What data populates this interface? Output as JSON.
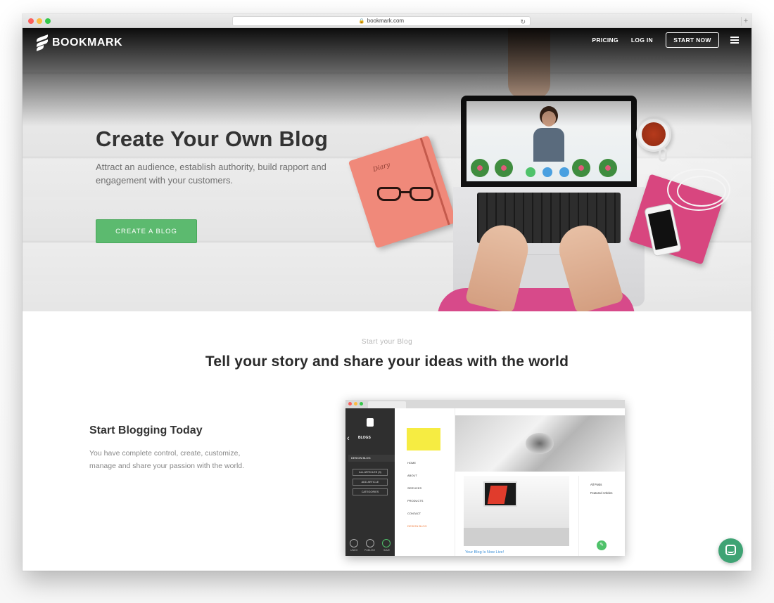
{
  "browser": {
    "url": "bookmark.com"
  },
  "nav": {
    "logo_text": "BOOKMARK",
    "links": [
      "PRICING",
      "LOG IN"
    ],
    "cta": "START NOW"
  },
  "hero": {
    "title": "Create Your Own Blog",
    "subtitle": "Attract an audience, establish authority, build rapport and engagement with your customers.",
    "cta": "CREATE A BLOG",
    "notebook_text": "Diary"
  },
  "section": {
    "kicker": "Start your Blog",
    "title": "Tell your story and share your ideas with the world"
  },
  "feature": {
    "title": "Start Blogging Today",
    "text": "You have complete control, create, customize, manage and share your passion with the world."
  },
  "editor_mockup": {
    "sidebar_title": "BLOGS",
    "active_blog": "DESIGN BLOG",
    "buttons": [
      "ALL ARTICLES (3)",
      "ADD ARTICLE",
      "CATEGORIES"
    ],
    "bottom_actions": [
      "UNDO",
      "PUBLISH",
      "SAVE"
    ],
    "site_nav": [
      "HOME",
      "ABOUT",
      "SERVICES",
      "PRODUCTS",
      "CONTACT",
      "DESIGN BLOG"
    ],
    "post_caption": "Your Blog Is Now Live!",
    "side_links": [
      "All Posts",
      "Featured Articles"
    ]
  },
  "colors": {
    "accent_green": "#5cba6f",
    "chat_green": "#3fa374",
    "active_orange": "#f07c3c",
    "link_blue": "#3b8fd6"
  },
  "icons": [
    "lock-icon",
    "reload-icon",
    "new-tab-icon",
    "bookmark-logo-icon",
    "hamburger-menu-icon",
    "back-arrow-icon",
    "undo-icon",
    "publish-icon",
    "save-check-icon",
    "edit-pencil-icon",
    "chat-icon"
  ]
}
